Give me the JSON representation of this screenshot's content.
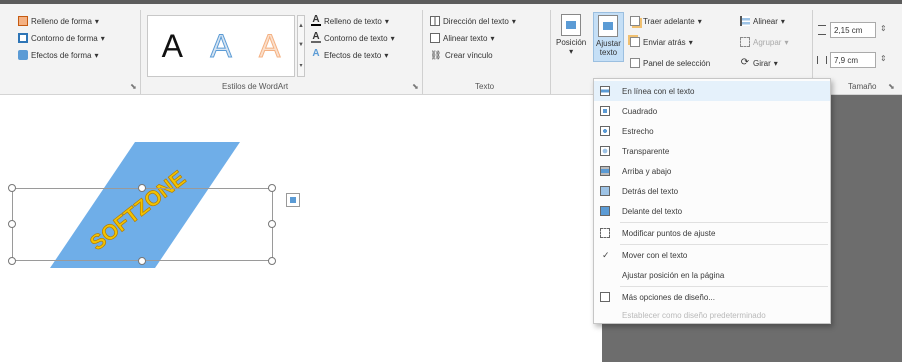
{
  "ribbon": {
    "shape_styles": {
      "fill": "Relleno de forma",
      "outline": "Contorno de forma",
      "effects": "Efectos de forma",
      "group_label": ""
    },
    "wordart": {
      "styles": [
        "A",
        "A",
        "A"
      ],
      "text_fill": "Relleno de texto",
      "text_outline": "Contorno de texto",
      "text_effects": "Efectos de texto",
      "group_label": "Estilos de WordArt"
    },
    "text": {
      "direction": "Dirección del texto",
      "align": "Alinear texto",
      "link": "Crear vínculo",
      "group_label": "Texto"
    },
    "arrange": {
      "position": "Posición",
      "wrap_line1": "Ajustar",
      "wrap_line2": "texto",
      "bring_forward": "Traer adelante",
      "send_backward": "Enviar atrás",
      "selection_pane": "Panel de selección",
      "align": "Alinear",
      "group": "Agrupar",
      "rotate": "Girar"
    },
    "size": {
      "height": "2,15 cm",
      "width": "7,9 cm",
      "group_label": "Tamaño"
    }
  },
  "document": {
    "wordart_text": "SOFTZONE"
  },
  "wrap_menu": {
    "items": [
      {
        "label": "En línea con el texto",
        "icon": "inline-wrap-icon",
        "enabled": true
      },
      {
        "label": "Cuadrado",
        "icon": "square-wrap-icon",
        "enabled": true
      },
      {
        "label": "Estrecho",
        "icon": "tight-wrap-icon",
        "enabled": true
      },
      {
        "label": "Transparente",
        "icon": "through-wrap-icon",
        "enabled": true
      },
      {
        "label": "Arriba y abajo",
        "icon": "top-bottom-wrap-icon",
        "enabled": true
      },
      {
        "label": "Detrás del texto",
        "icon": "behind-text-icon",
        "enabled": true
      },
      {
        "label": "Delante del texto",
        "icon": "in-front-text-icon",
        "enabled": true
      },
      {
        "label": "Modificar puntos de ajuste",
        "icon": "edit-wrap-points-icon",
        "enabled": true
      },
      {
        "label": "Mover con el texto",
        "icon": "check-icon",
        "enabled": true,
        "checked": true
      },
      {
        "label": "Ajustar posición en la página",
        "icon": "",
        "enabled": true
      },
      {
        "label": "Más opciones de diseño...",
        "icon": "more-layout-icon",
        "enabled": true
      },
      {
        "label": "Establecer como diseño predeterminado",
        "icon": "",
        "enabled": false
      }
    ]
  },
  "colors": {
    "wordart_shape": "#6faee8",
    "wordart_text": "#f2c200",
    "ribbon_bg": "#f3f3f3",
    "gray_area": "#6d6d6d",
    "active_button": "#c5dff6"
  }
}
